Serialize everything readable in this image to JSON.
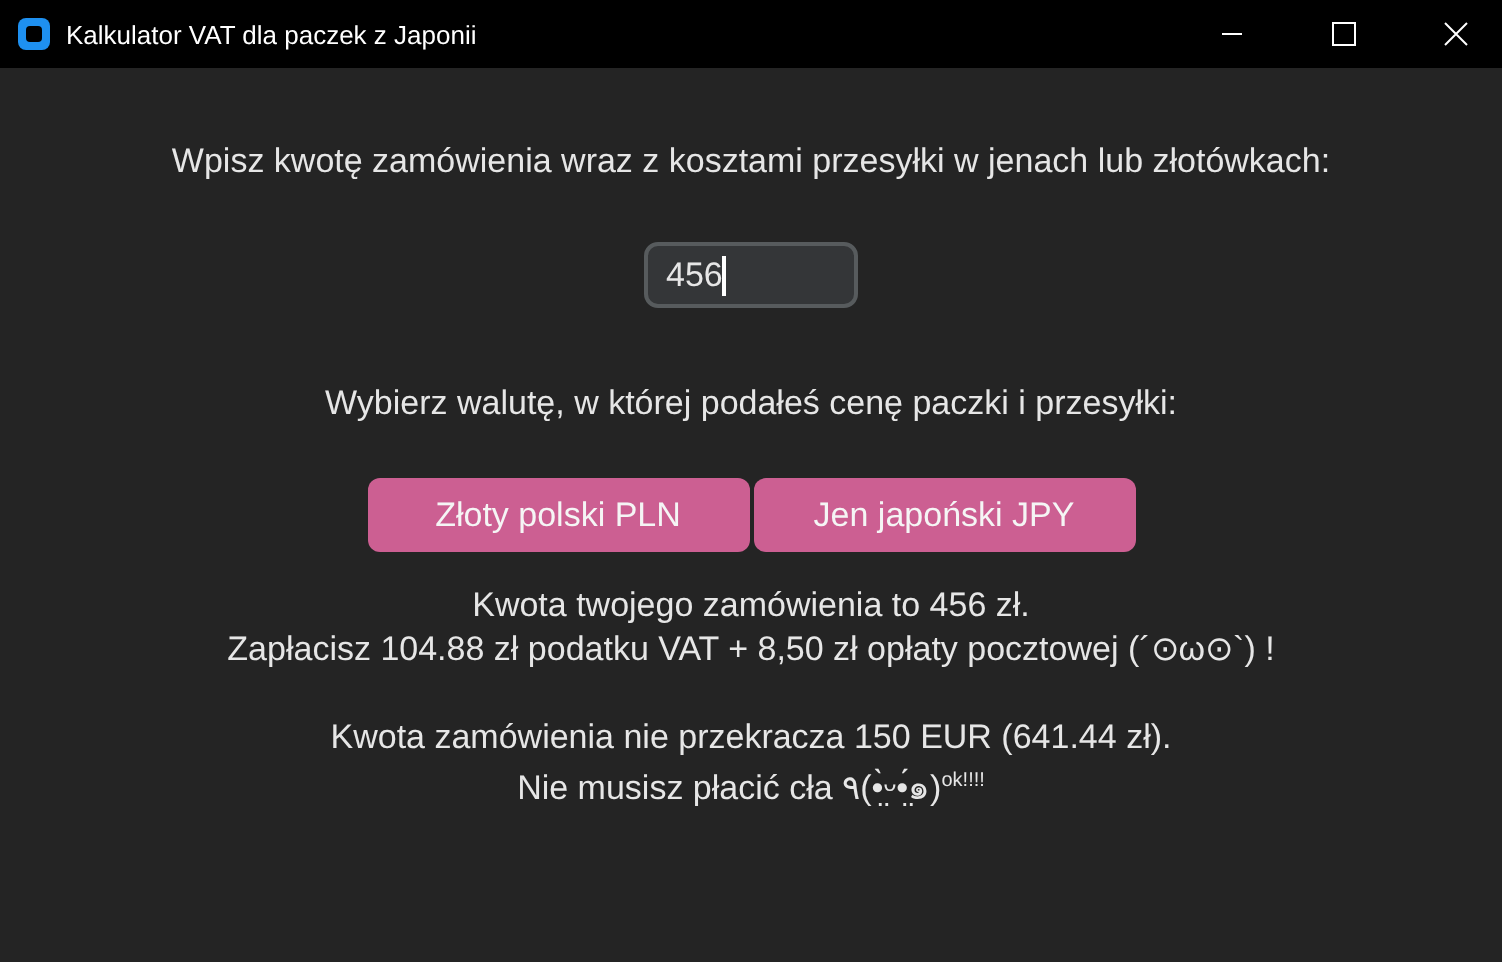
{
  "window": {
    "title": "Kalkulator VAT dla paczek z Japonii"
  },
  "amount_prompt": "Wpisz kwotę zamówienia wraz z kosztami przesyłki w jenach lub złotówkach:",
  "amount_field": {
    "value": "456"
  },
  "currency_prompt": "Wybierz walutę, w której podałeś cenę paczki i przesyłki:",
  "currency_buttons": [
    "Złoty polski PLN",
    "Jen japoński JPY"
  ],
  "result_lines": [
    "Kwota twojego zamówienia to 456 zł.",
    "Zapłacisz 104.88 zł podatku VAT + 8,50 zł opłaty pocztowej (´⊙ω⊙`) !"
  ],
  "duty_lines": [
    "Kwota zamówienia nie przekracza 150 EUR (641.44 zł).",
    "Nie musisz płacić cła ٩(•̤̀ᵕ•̤́๑)$^{ok!!!!}$"
  ]
}
